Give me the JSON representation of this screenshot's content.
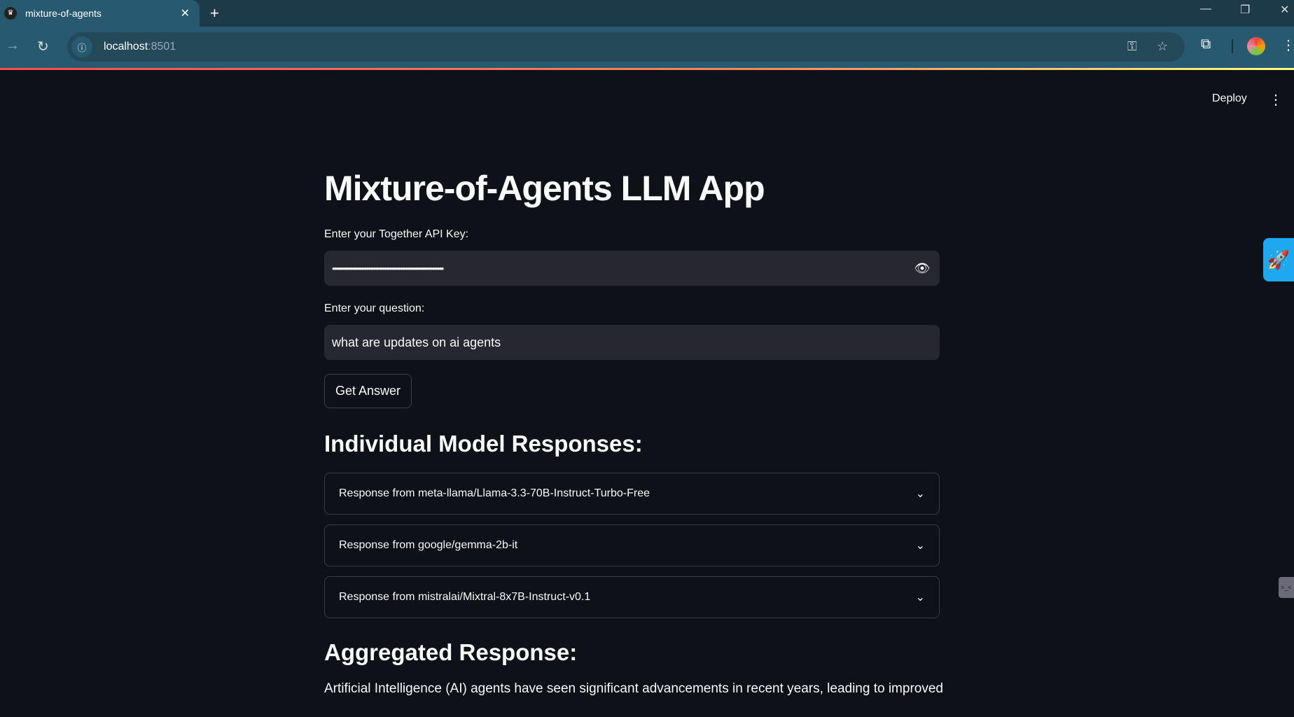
{
  "browser": {
    "tab_title": "mixture-of-agents",
    "url_host": "localhost",
    "url_port": ":8501"
  },
  "header": {
    "deploy_label": "Deploy"
  },
  "main": {
    "title": "Mixture-of-Agents LLM App",
    "api_key": {
      "label": "Enter your Together API Key:",
      "value": "••••••••••••••••••••••••••••••••••••••••••••••••••••••••••••••"
    },
    "question": {
      "label": "Enter your question:",
      "value": "what are updates on ai agents"
    },
    "get_answer_label": "Get Answer",
    "individual_heading": "Individual Model Responses:",
    "responses": [
      {
        "label": "Response from meta-llama/Llama-3.3-70B-Instruct-Turbo-Free"
      },
      {
        "label": "Response from google/gemma-2b-it"
      },
      {
        "label": "Response from mistralai/Mixtral-8x7B-Instruct-v0.1"
      }
    ],
    "aggregated_heading": "Aggregated Response:",
    "aggregated_text": "Artificial Intelligence (AI) agents have seen significant advancements in recent years, leading to improved"
  }
}
